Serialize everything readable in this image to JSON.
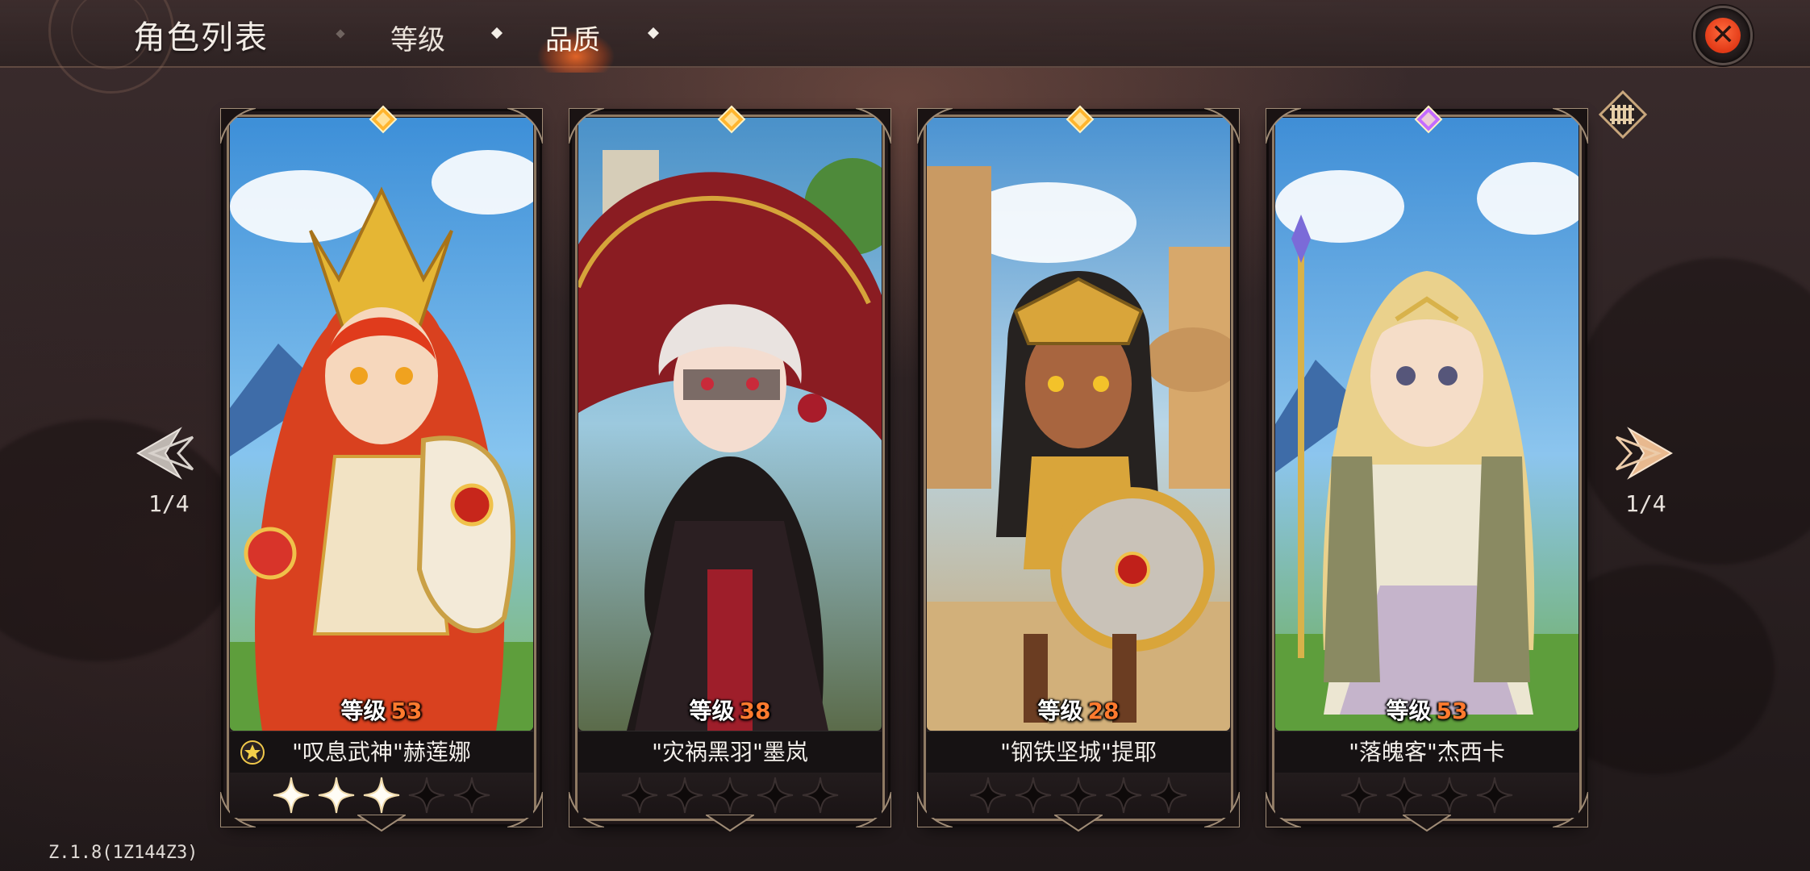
{
  "header": {
    "title": "角色列表",
    "tabs": [
      {
        "label": "等级",
        "active": false
      },
      {
        "label": "品质",
        "active": true
      }
    ]
  },
  "pagination": {
    "left": "1/4",
    "right": "1/4"
  },
  "level_label": "等级",
  "characters": [
    {
      "name": "\"叹息武神\"赫莲娜",
      "level": "53",
      "quality_color": "#ffb52e",
      "stars_filled": 3,
      "stars_total": 5,
      "favorite": true
    },
    {
      "name": "\"灾祸黑羽\"墨岚",
      "level": "38",
      "quality_color": "#ffb52e",
      "stars_filled": 0,
      "stars_total": 5,
      "favorite": false
    },
    {
      "name": "\"钢铁坚城\"提耶",
      "level": "28",
      "quality_color": "#ffb52e",
      "stars_filled": 0,
      "stars_total": 5,
      "favorite": false
    },
    {
      "name": "\"落魄客\"杰西卡",
      "level": "53",
      "quality_color": "#c46bff",
      "stars_filled": 0,
      "stars_total": 4,
      "favorite": false
    }
  ],
  "version": "Z.1.8(1Z144Z3)",
  "colors": {
    "level_number": "#ff7a2e",
    "close_button": "#e23a17",
    "active_tab_glow": "#ff6e28"
  },
  "icons": {
    "close": "close-x-icon",
    "prev": "prev-arrow-icon",
    "next": "next-arrow-icon",
    "formation": "formation-grid-icon",
    "favorite": "favorite-star-icon"
  }
}
